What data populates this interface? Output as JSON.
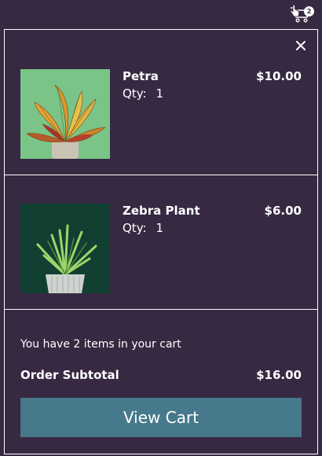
{
  "header": {
    "cart_count": "2",
    "cart_icon": "cart-icon",
    "cursor_icon": "hand-pointer-icon"
  },
  "panel": {
    "close_icon": "close-icon",
    "items": [
      {
        "name": "Petra",
        "qty_label": "Qty:",
        "qty": "1",
        "price": "$10.00",
        "image": "croton-plant-image"
      },
      {
        "name": "Zebra Plant",
        "qty_label": "Qty:",
        "qty": "1",
        "price": "$6.00",
        "image": "zebra-plant-image"
      }
    ],
    "summary": {
      "count_text": "You have 2 items in your cart",
      "subtotal_label": "Order Subtotal",
      "subtotal_value": "$16.00"
    },
    "view_cart_label": "View Cart"
  },
  "colors": {
    "background": "#372942",
    "button": "#46798b",
    "text": "#ffffff"
  }
}
